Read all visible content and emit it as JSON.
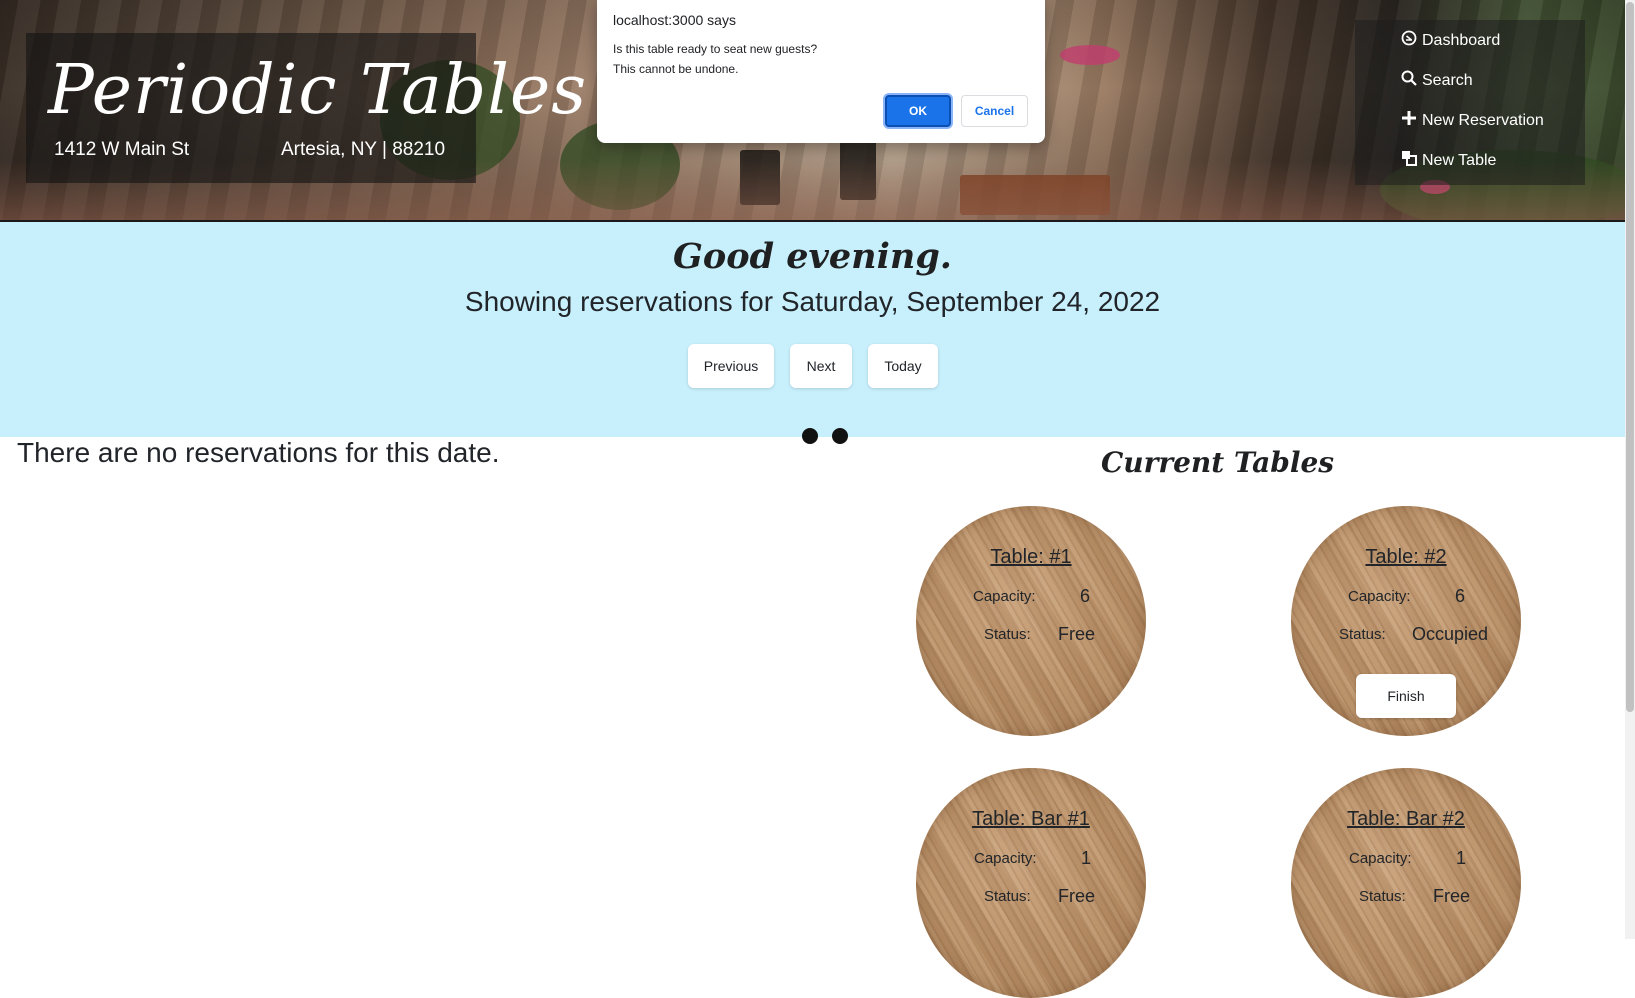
{
  "header": {
    "brand_title": "Periodic Tables",
    "address": "1412 W Main St",
    "city": "Artesia, NY | 88210"
  },
  "nav": {
    "items": [
      {
        "label": "Dashboard",
        "icon": "dashboard-icon"
      },
      {
        "label": "Search",
        "icon": "search-icon"
      },
      {
        "label": "New Reservation",
        "icon": "plus-icon"
      },
      {
        "label": "New Table",
        "icon": "layers-icon"
      }
    ]
  },
  "datebar": {
    "greeting": "Good evening.",
    "date_line": "Showing reservations for Saturday, September 24, 2022",
    "previous_label": "Previous",
    "next_label": "Next",
    "today_label": "Today"
  },
  "reservations": {
    "empty_message": "There are no reservations for this date."
  },
  "tables": {
    "title": "Current Tables",
    "capacity_label": "Capacity:",
    "status_label": "Status:",
    "finish_label": "Finish",
    "items": [
      {
        "name": "Table: #1",
        "capacity": "6",
        "status": "Free"
      },
      {
        "name": "Table: #2",
        "capacity": "6",
        "status": "Occupied"
      },
      {
        "name": "Table: Bar #1",
        "capacity": "1",
        "status": "Free"
      },
      {
        "name": "Table: Bar #2",
        "capacity": "1",
        "status": "Free"
      }
    ]
  },
  "dialog": {
    "title": "localhost:3000 says",
    "message_line1": "Is this table ready to seat new guests?",
    "message_line2": "This cannot be undone.",
    "ok_label": "OK",
    "cancel_label": "Cancel"
  },
  "colors": {
    "datebar_bg": "#c8f0fc",
    "dialog_ok": "#1a73e8"
  }
}
